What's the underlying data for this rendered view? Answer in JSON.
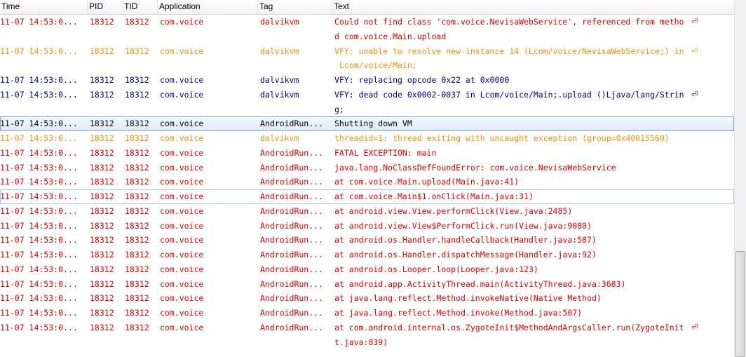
{
  "header": {
    "time": "Time",
    "pid": "PID",
    "tid": "TID",
    "application": "Application",
    "tag": "Tag",
    "text": "Text"
  },
  "rows": [
    {
      "time": "11-07 14:53:0...",
      "pid": "18312",
      "tid": "18312",
      "app": "com.voice",
      "tag": "dalvikvm",
      "text": "Could not find class 'com.voice.NevisaWebService', referenced from metho",
      "text2": "d com.voice.Main.upload",
      "level": "e",
      "wrap": true
    },
    {
      "time": "11-07 14:53:0...",
      "pid": "18312",
      "tid": "18312",
      "app": "com.voice",
      "tag": "dalvikvm",
      "text": "VFY: unable to resolve new-instance 14 (Lcom/voice/NevisaWebService;) in",
      "text2": " Lcom/voice/Main;",
      "level": "w",
      "wrap": true
    },
    {
      "time": "11-07 14:53:0...",
      "pid": "18312",
      "tid": "18312",
      "app": "com.voice",
      "tag": "dalvikvm",
      "text": "VFY: replacing opcode 0x22 at 0x0000",
      "level": "d"
    },
    {
      "time": "11-07 14:53:0...",
      "pid": "18312",
      "tid": "18312",
      "app": "com.voice",
      "tag": "dalvikvm",
      "text": "VFY: dead code 0x0002-0037 in Lcom/voice/Main;.upload ()Ljava/lang/Strin",
      "text2": "g;",
      "level": "d",
      "wrap": true
    },
    {
      "time": "11-07 14:53:0...",
      "pid": "18312",
      "tid": "18312",
      "app": "com.voice",
      "tag": "AndroidRun...",
      "text": "Shutting down VM",
      "level": "i",
      "selected": true
    },
    {
      "time": "11-07 14:53:0...",
      "pid": "18312",
      "tid": "18312",
      "app": "com.voice",
      "tag": "dalvikvm",
      "text": "threadid=1: thread exiting with uncaught exception (group=0x40015560)",
      "level": "w"
    },
    {
      "time": "11-07 14:53:0...",
      "pid": "18312",
      "tid": "18312",
      "app": "com.voice",
      "tag": "AndroidRun...",
      "text": "FATAL EXCEPTION: main",
      "level": "e"
    },
    {
      "time": "11-07 14:53:0...",
      "pid": "18312",
      "tid": "18312",
      "app": "com.voice",
      "tag": "AndroidRun...",
      "text": "java.lang.NoClassDefFoundError: com.voice.NevisaWebService",
      "level": "e"
    },
    {
      "time": "11-07 14:53:0...",
      "pid": "18312",
      "tid": "18312",
      "app": "com.voice",
      "tag": "AndroidRun...",
      "text": "at com.voice.Main.upload(Main.java:41)",
      "level": "e"
    },
    {
      "time": "11-07 14:53:0...",
      "pid": "18312",
      "tid": "18312",
      "app": "com.voice",
      "tag": "AndroidRun...",
      "text": "at com.voice.Main$1.onClick(Main.java:31)",
      "level": "e",
      "hover": true
    },
    {
      "time": "11-07 14:53:0...",
      "pid": "18312",
      "tid": "18312",
      "app": "com.voice",
      "tag": "AndroidRun...",
      "text": "at android.view.View.performClick(View.java:2485)",
      "level": "e"
    },
    {
      "time": "11-07 14:53:0...",
      "pid": "18312",
      "tid": "18312",
      "app": "com.voice",
      "tag": "AndroidRun...",
      "text": "at android.view.View$PerformClick.run(View.java:9080)",
      "level": "e"
    },
    {
      "time": "11-07 14:53:0...",
      "pid": "18312",
      "tid": "18312",
      "app": "com.voice",
      "tag": "AndroidRun...",
      "text": "at android.os.Handler.handleCallback(Handler.java:587)",
      "level": "e"
    },
    {
      "time": "11-07 14:53:0...",
      "pid": "18312",
      "tid": "18312",
      "app": "com.voice",
      "tag": "AndroidRun...",
      "text": "at android.os.Handler.dispatchMessage(Handler.java:92)",
      "level": "e"
    },
    {
      "time": "11-07 14:53:0...",
      "pid": "18312",
      "tid": "18312",
      "app": "com.voice",
      "tag": "AndroidRun...",
      "text": "at android.os.Looper.loop(Looper.java:123)",
      "level": "e"
    },
    {
      "time": "11-07 14:53:0...",
      "pid": "18312",
      "tid": "18312",
      "app": "com.voice",
      "tag": "AndroidRun...",
      "text": "at android.app.ActivityThread.main(ActivityThread.java:3683)",
      "level": "e"
    },
    {
      "time": "11-07 14:53:0...",
      "pid": "18312",
      "tid": "18312",
      "app": "com.voice",
      "tag": "AndroidRun...",
      "text": "at java.lang.reflect.Method.invokeNative(Native Method)",
      "level": "e"
    },
    {
      "time": "11-07 14:53:0...",
      "pid": "18312",
      "tid": "18312",
      "app": "com.voice",
      "tag": "AndroidRun...",
      "text": "at java.lang.reflect.Method.invoke(Method.java:507)",
      "level": "e"
    },
    {
      "time": "11-07 14:53:0...",
      "pid": "18312",
      "tid": "18312",
      "app": "com.voice",
      "tag": "AndroidRun...",
      "text": "at com.android.internal.os.ZygoteInit$MethodAndArgsCaller.run(ZygoteInit",
      "text2": "t.java:839)",
      "level": "e",
      "wrap": true
    }
  ],
  "wrap_glyph": "⏎",
  "colors": {
    "error": "#e00000",
    "warning": "#ff8c00",
    "debug": "#00008b",
    "info": "#000000"
  }
}
